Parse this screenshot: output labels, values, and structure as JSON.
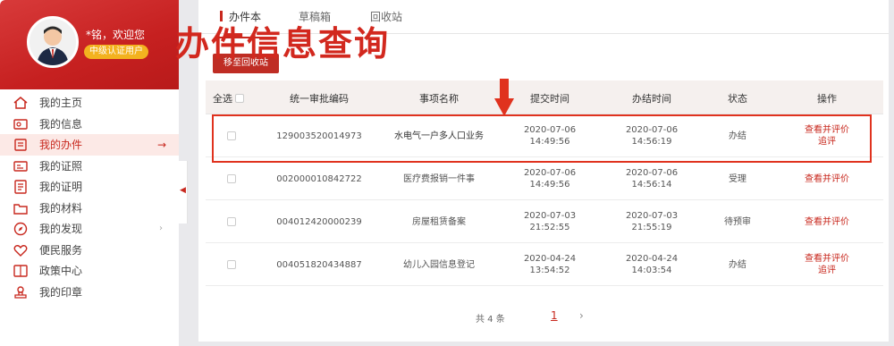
{
  "overlay_title": "办件信息查询",
  "user": {
    "greeting": "*铭，欢迎您",
    "level": "中级认证用户"
  },
  "nav": [
    {
      "label": "我的主页",
      "icon": "home-icon"
    },
    {
      "label": "我的信息",
      "icon": "id-card-icon"
    },
    {
      "label": "我的办件",
      "icon": "folder-icon",
      "active": true
    },
    {
      "label": "我的证照",
      "icon": "license-icon"
    },
    {
      "label": "我的证明",
      "icon": "certificate-icon"
    },
    {
      "label": "我的材料",
      "icon": "materials-icon"
    },
    {
      "label": "我的发现",
      "icon": "compass-icon"
    },
    {
      "label": "便民服务",
      "icon": "service-icon"
    },
    {
      "label": "政策中心",
      "icon": "policy-icon"
    },
    {
      "label": "我的印章",
      "icon": "stamp-icon"
    }
  ],
  "tabs": [
    "办件本",
    "草稿箱",
    "回收站"
  ],
  "move_button": "移至回收站",
  "table": {
    "headers": {
      "select_all": "全选",
      "code": "统一审批编码",
      "name": "事项名称",
      "submit_time": "提交时间",
      "finish_time": "办结时间",
      "status": "状态",
      "action": "操作"
    },
    "rows": [
      {
        "code": "129003520014973",
        "name": "水电气一户多人口业务",
        "submit_date": "2020-07-06",
        "submit_time": "14:49:56",
        "finish_date": "2020-07-06",
        "finish_time": "14:56:19",
        "status": "办结",
        "action1": "查看并评价",
        "action2": "追评"
      },
      {
        "code": "002000010842722",
        "name": "医疗费报销一件事",
        "submit_date": "2020-07-06",
        "submit_time": "14:49:56",
        "finish_date": "2020-07-06",
        "finish_time": "14:56:14",
        "status": "受理",
        "action1": "查看并评价",
        "action2": ""
      },
      {
        "code": "004012420000239",
        "name": "房屋租赁备案",
        "submit_date": "2020-07-03",
        "submit_time": "21:52:55",
        "finish_date": "2020-07-03",
        "finish_time": "21:55:19",
        "status": "待预审",
        "action1": "查看并评价",
        "action2": ""
      },
      {
        "code": "004051820434887",
        "name": "幼儿入园信息登记",
        "submit_date": "2020-04-24",
        "submit_time": "13:54:52",
        "finish_date": "2020-04-24",
        "finish_time": "14:03:54",
        "status": "办结",
        "action1": "查看并评价",
        "action2": "追评"
      }
    ]
  },
  "pager": {
    "total": "共 4 条",
    "current": "1",
    "next": "›"
  },
  "colors": {
    "accent": "#c8281e",
    "highlight": "#e0321e",
    "badge": "#f3b21f"
  }
}
